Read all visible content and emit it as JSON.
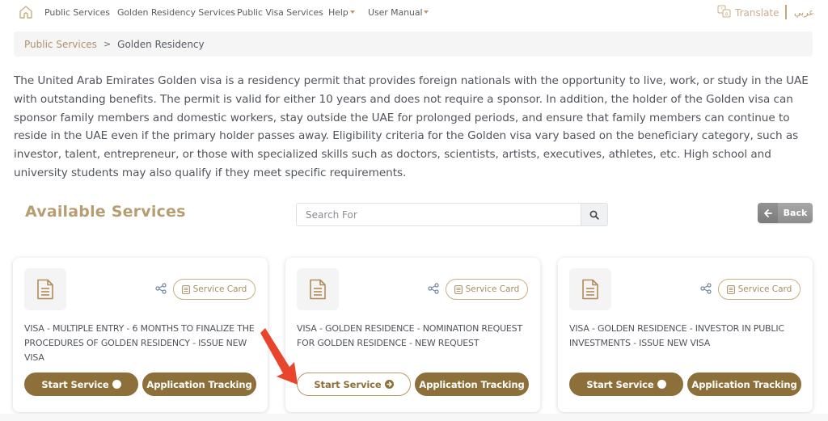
{
  "nav": {
    "home_icon": "home-icon",
    "items": [
      {
        "label": "Public Services"
      },
      {
        "label": "Golden Residency Services"
      },
      {
        "label": "Public Visa Services"
      },
      {
        "label": "Help",
        "dropdown": true
      },
      {
        "label": "User Manual",
        "dropdown": true
      }
    ],
    "translate_label": "Translate",
    "language_label": "عربي"
  },
  "breadcrumb": {
    "link": "Public Services",
    "separator": ">",
    "current": "Golden Residency"
  },
  "description": "The United Arab Emirates Golden visa is a residency permit that provides foreign nationals with the opportunity to live, work, or study in the UAE with outstanding benefits. The permit is valid for either 10 years and does not require a sponsor. In addition, the holder of the Golden visa can sponsor family members and domestic workers, stay outside the UAE for prolonged periods, and ensure that family members can continue to reside in the UAE even if the primary holder passes away. Eligibility criteria for the Golden visa vary based on the beneficiary category, such as investor, talent, entrepreneur, or those with specialized skills such as doctors, scientists, artists, executives, athletes, etc. High school and university students may also qualify if they meet specific requirements.",
  "services_section": {
    "title": "Available Services",
    "search_placeholder": "Search For",
    "search_value": "",
    "back_label": "Back"
  },
  "cards": [
    {
      "title": "VISA - MULTIPLE ENTRY - 6 MONTHS TO FINALIZE THE PROCEDURES OF GOLDEN RESIDENCY - ISSUE NEW VISA",
      "service_card_label": "Service Card",
      "start_label": "Start Service",
      "track_label": "Application Tracking",
      "start_style": "filled"
    },
    {
      "title": "VISA - GOLDEN RESIDENCE - NOMINATION REQUEST FOR GOLDEN RESIDENCE - NEW REQUEST",
      "service_card_label": "Service Card",
      "start_label": "Start Service",
      "track_label": "Application Tracking",
      "start_style": "outlined"
    },
    {
      "title": "VISA - GOLDEN RESIDENCE - INVESTOR IN PUBLIC INVESTMENTS - ISSUE NEW VISA",
      "service_card_label": "Service Card",
      "start_label": "Start Service",
      "track_label": "Application Tracking",
      "start_style": "filled"
    }
  ],
  "colors": {
    "brand_gold": "#8d6f3a",
    "accent_light_gold": "#b69d72",
    "annotation_arrow": "#e8452c"
  }
}
